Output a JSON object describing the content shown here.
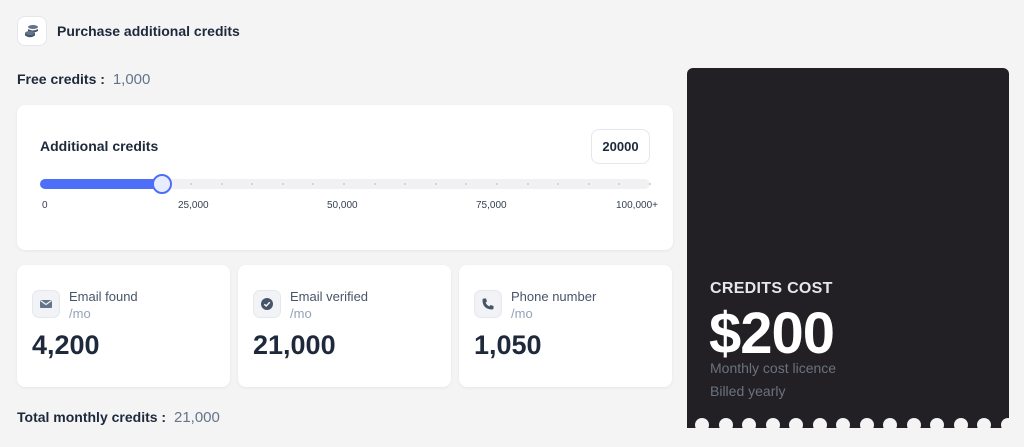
{
  "header": {
    "title": "Purchase additional credits",
    "icon": "coins-icon"
  },
  "free_credits": {
    "label": "Free credits :",
    "value": "1,000"
  },
  "slider": {
    "title": "Additional credits",
    "input_value": "20000",
    "value": 20000,
    "max": 100000,
    "fill_fraction": 0.2,
    "ticks": [
      "0",
      "25,000",
      "50,000",
      "75,000",
      "100,000+"
    ],
    "accent": "#4f6ef7"
  },
  "stats": [
    {
      "label": "Email found",
      "unit": "/mo",
      "value": "4,200",
      "icon": "mail-icon"
    },
    {
      "label": "Email verified",
      "unit": "/mo",
      "value": "21,000",
      "icon": "check-circle-icon"
    },
    {
      "label": "Phone number",
      "unit": "/mo",
      "value": "1,050",
      "icon": "phone-icon"
    }
  ],
  "total_credits": {
    "label": "Total monthly credits :",
    "value": "21,000"
  },
  "cost": {
    "title": "CREDITS COST",
    "value": "$200",
    "subtitle": "Monthly cost licence",
    "billing": "Billed yearly",
    "background": "#222024"
  }
}
